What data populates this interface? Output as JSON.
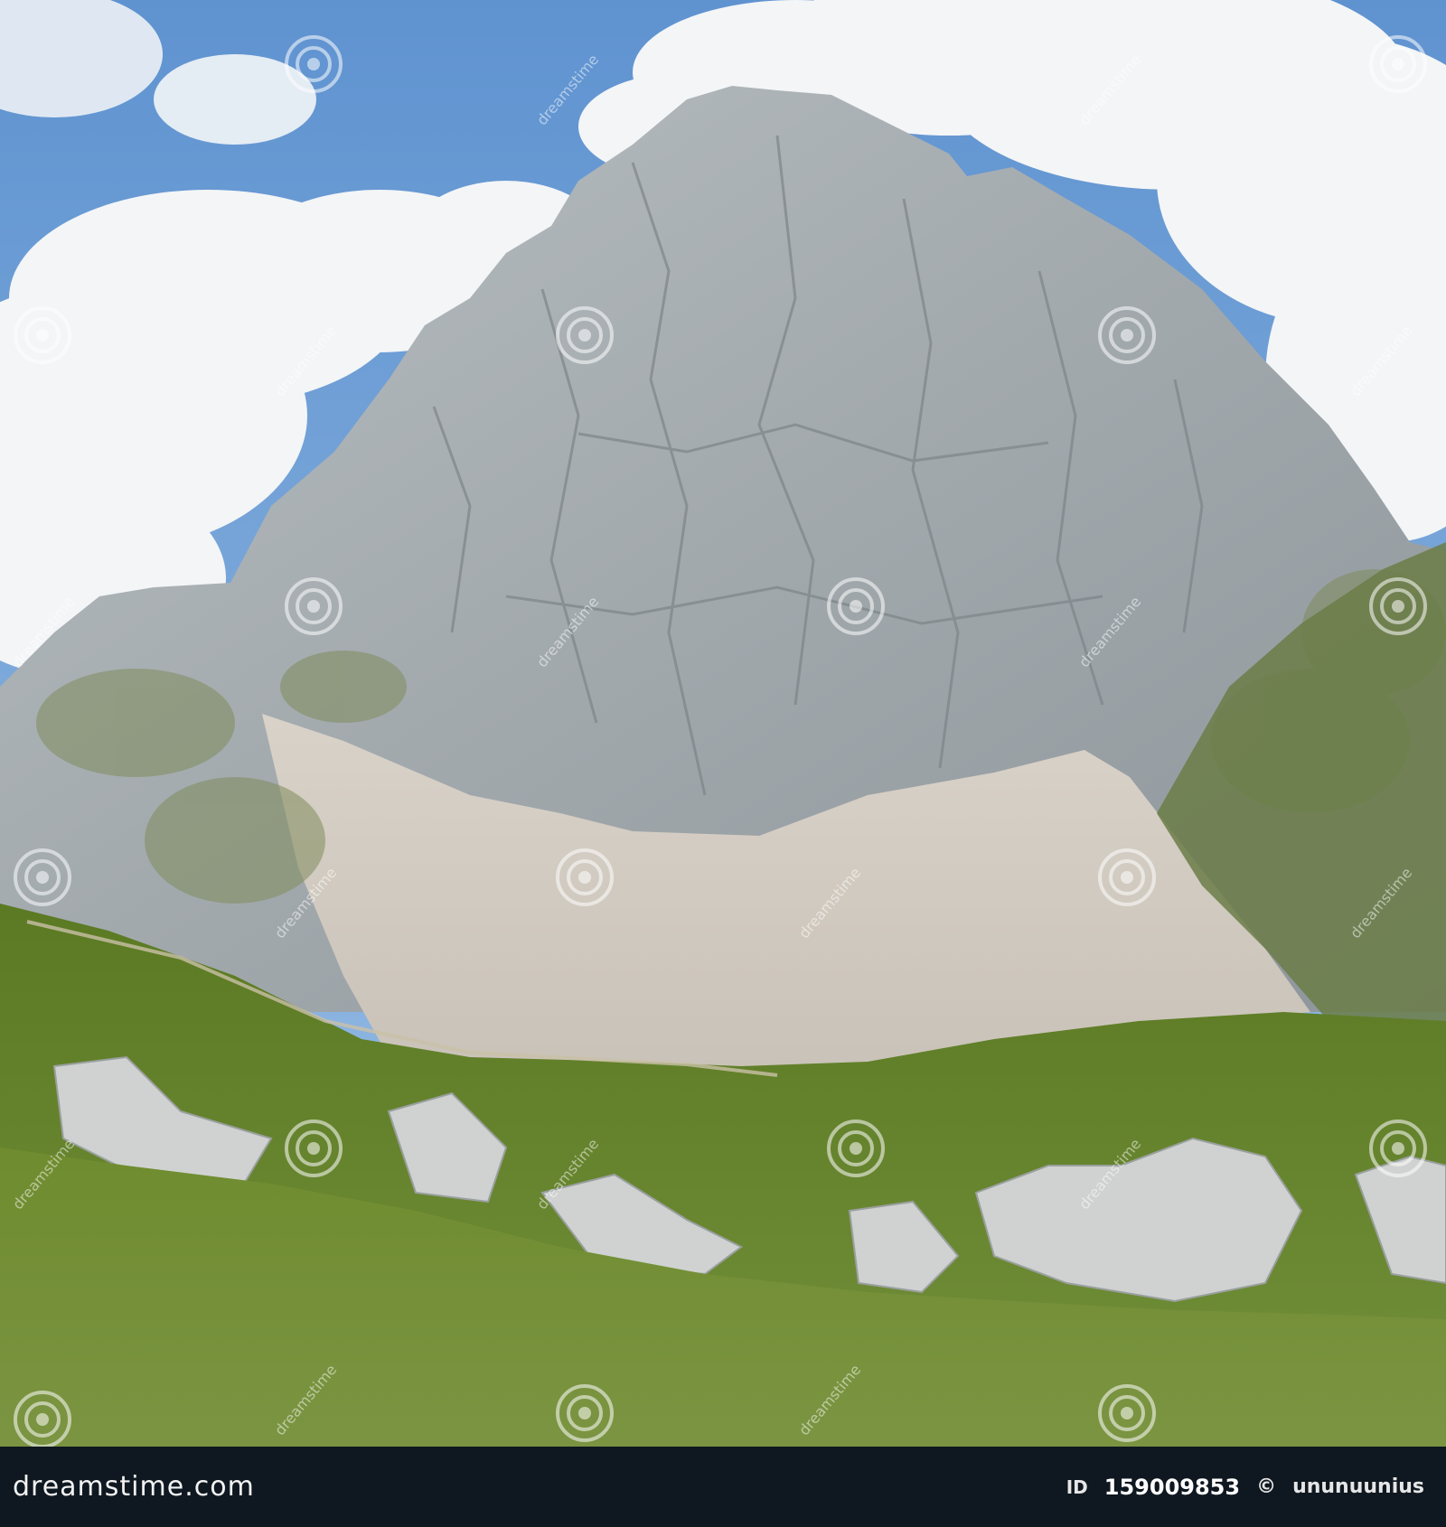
{
  "watermark": {
    "text": "dreamstime",
    "icon": "spiral-watermark-icon"
  },
  "footer": {
    "brand": "dreamstime.com",
    "id_label": "ID",
    "id_number": "159009853",
    "copyright_symbol": "©",
    "author": "ununuunius"
  },
  "colors": {
    "sky": "#6ea0d8",
    "cloud": "#f4f6f8",
    "rock": "#a7adb0",
    "scree": "#d7cfc4",
    "grass": "#5f7a2a",
    "footer_bg": "#0f1820"
  }
}
